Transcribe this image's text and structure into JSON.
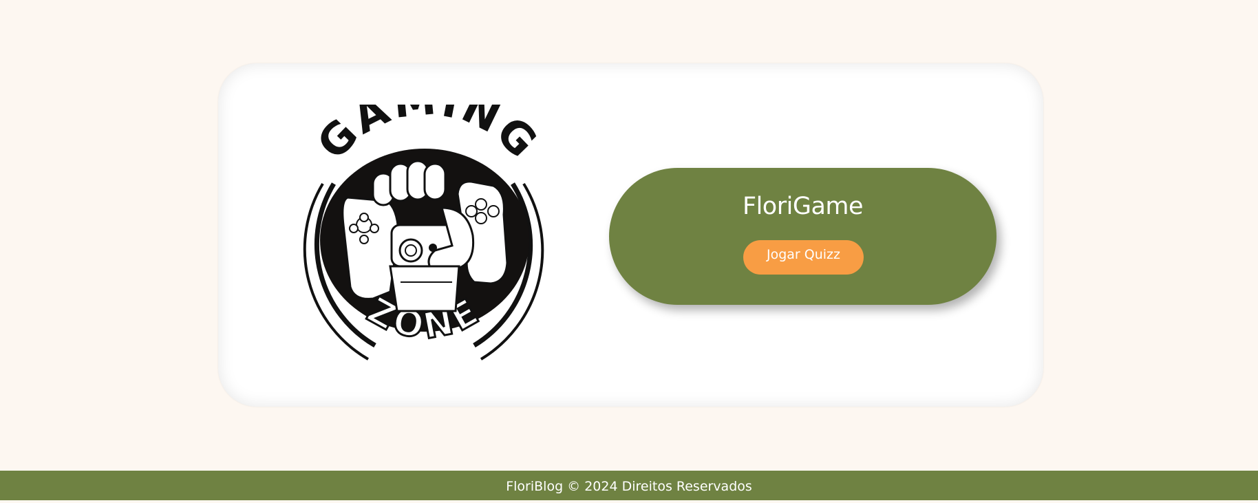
{
  "logo": {
    "top_text": "GAMING",
    "bottom_text": "ZONE"
  },
  "game": {
    "title": "FloriGame",
    "button_label": "Jogar Quizz"
  },
  "footer": {
    "text": "FloriBlog © 2024 Direitos Reservados"
  },
  "colors": {
    "page_background": "#fdf7f1",
    "card_background": "#ffffff",
    "panel_green": "#6f8242",
    "button_orange": "#f89d44",
    "text_white": "#ffffff"
  }
}
